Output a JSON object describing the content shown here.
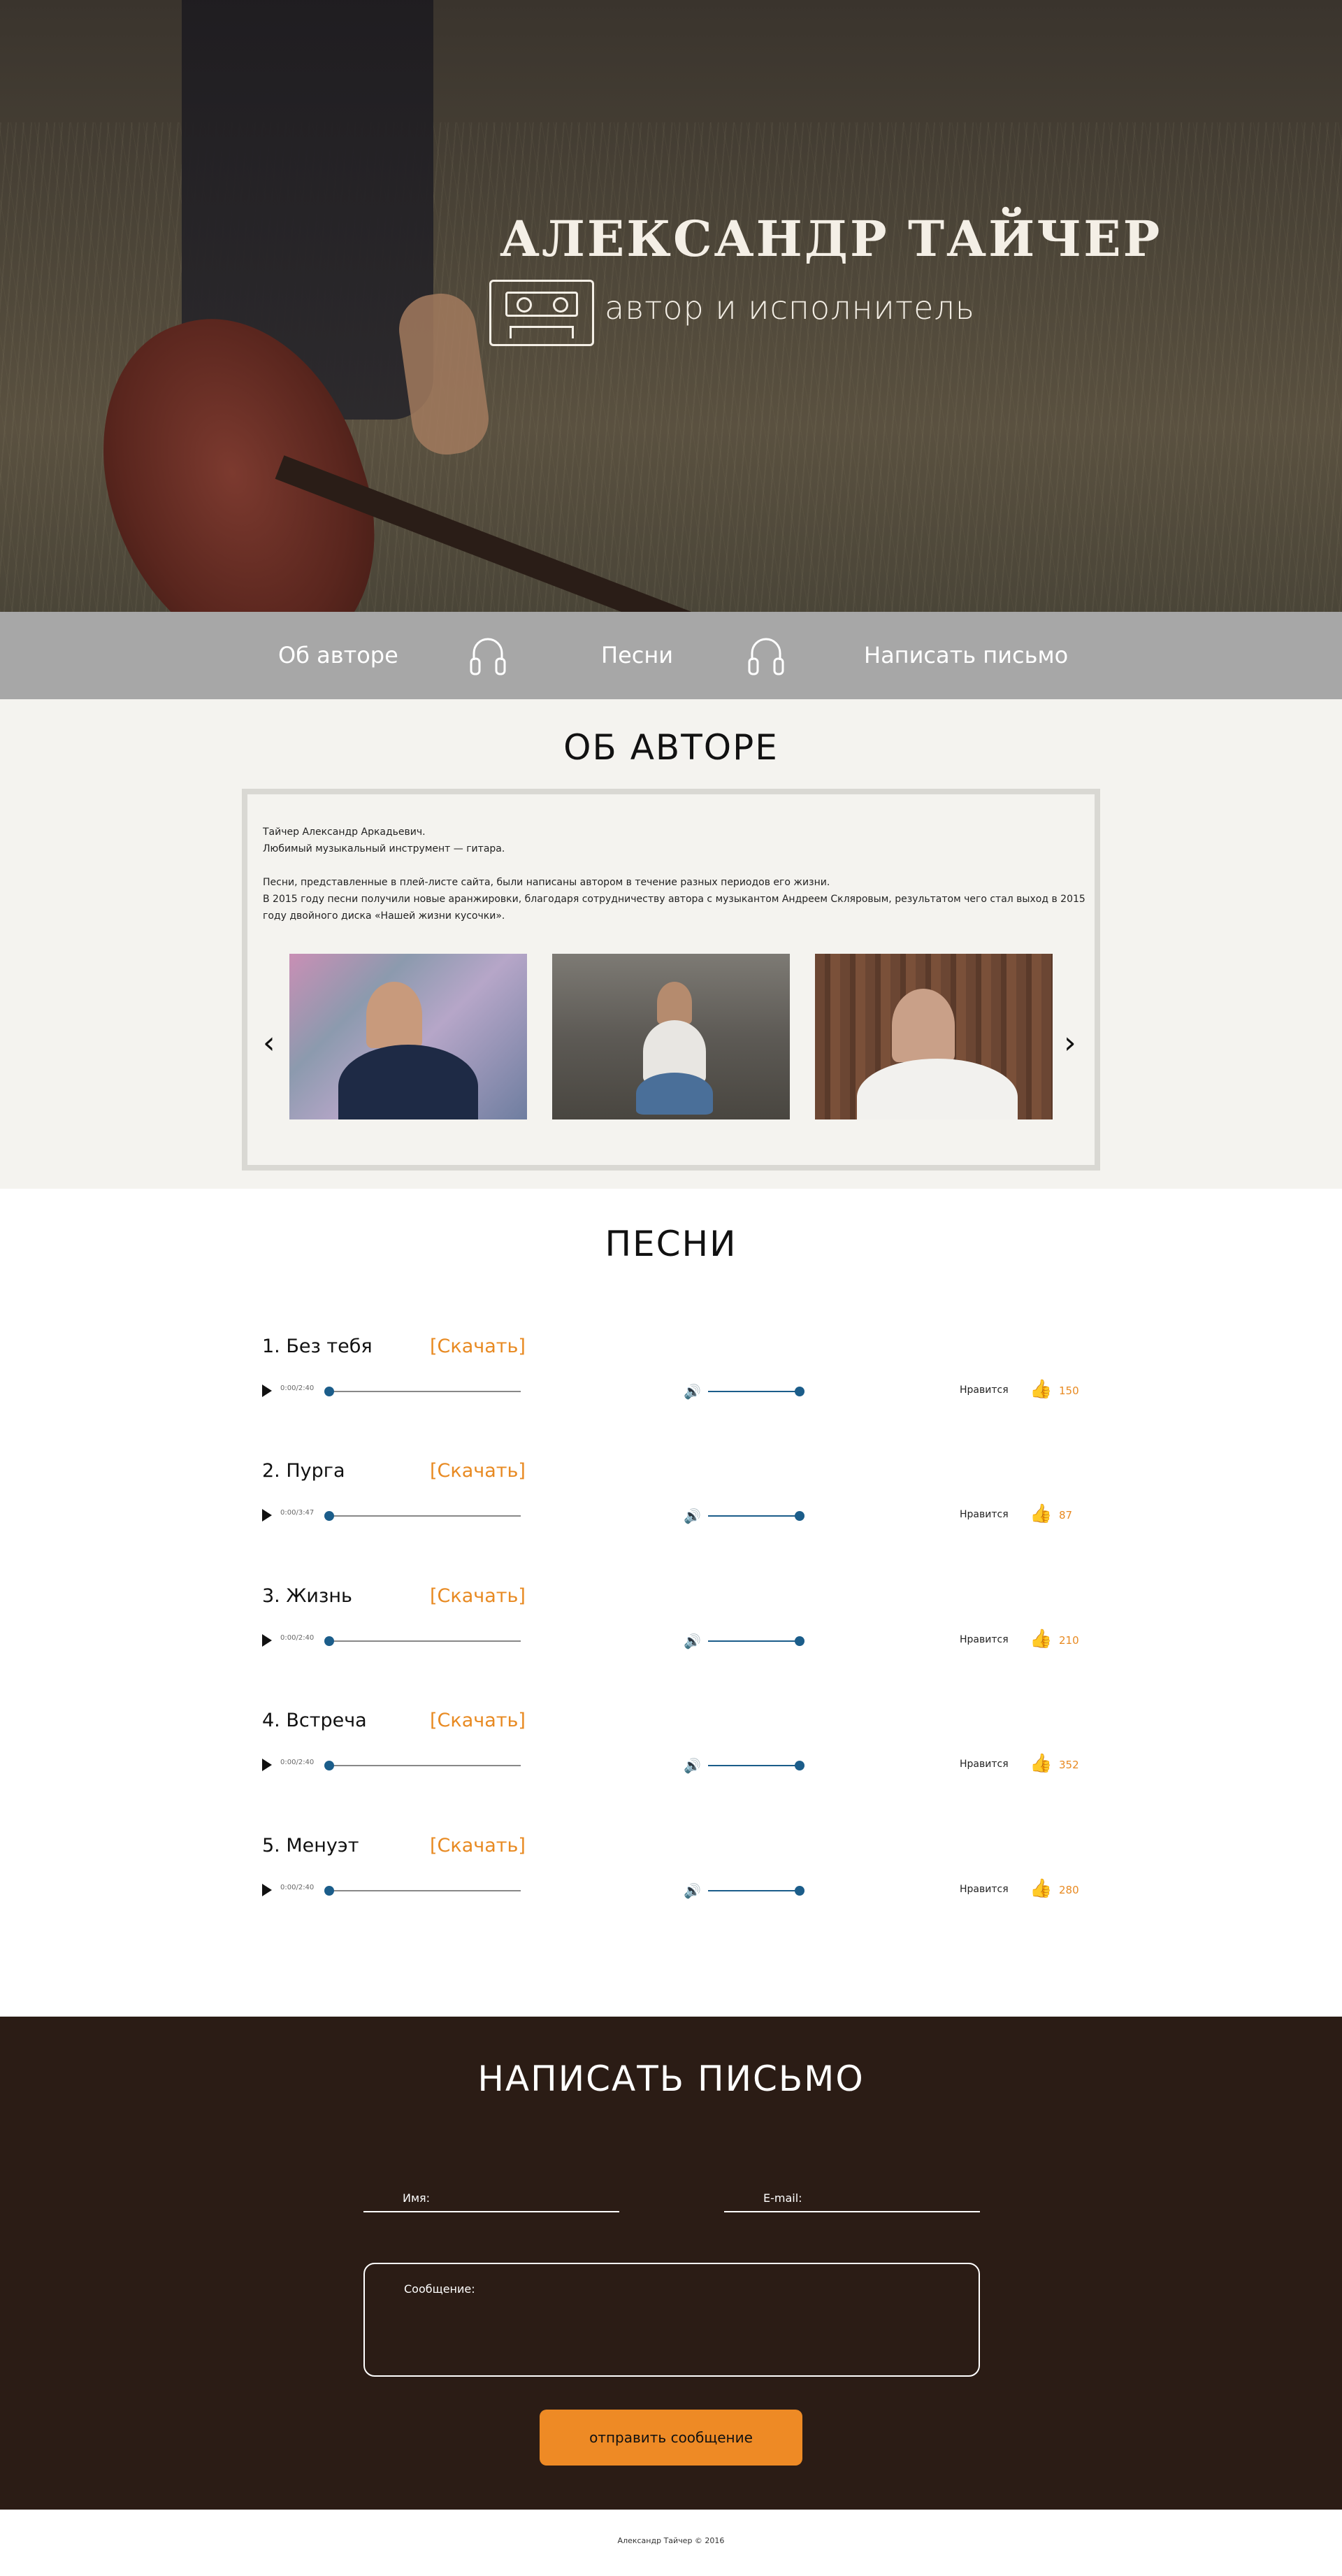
{
  "hero": {
    "title": "АЛЕКСАНДР ТАЙЧЕР",
    "subtitle": "автор и исполнитель"
  },
  "nav": {
    "items": [
      "Об авторе",
      "Песни",
      "Написать письмо"
    ]
  },
  "about": {
    "heading": "ОБ АВТОРЕ",
    "lines": [
      "Тайчер Александр Аркадьевич.",
      "Любимый музыкальный инструмент — гитара.",
      "Песни, представленные в плей-листе сайта, были написаны автором в течение разных периодов его жизни.",
      "В 2015 году песни получили новые аранжировки, благодаря сотрудничеству автора с музыкантом Андреем Скляровым, результатом чего стал выход в 2015 году двойного диска «Нашей жизни кусочки»."
    ],
    "arrow_left": "‹",
    "arrow_right": "›"
  },
  "songs": {
    "heading": "ПЕСНИ",
    "download_label": "[Скачать]",
    "like_label": "Нравится",
    "items": [
      {
        "title": "1. Без тебя",
        "time": "0:00/2:40",
        "likes": "150"
      },
      {
        "title": "2. Пурга",
        "time": "0:00/3:47",
        "likes": "87"
      },
      {
        "title": "3. Жизнь",
        "time": "0:00/2:40",
        "likes": "210"
      },
      {
        "title": "4. Встреча",
        "time": "0:00/2:40",
        "likes": "352"
      },
      {
        "title": "5. Менуэт",
        "time": "0:00/2:40",
        "likes": "280"
      }
    ]
  },
  "contact": {
    "heading": "НАПИСАТЬ ПИСЬМО",
    "name_placeholder": "Имя:",
    "email_placeholder": "E-mail:",
    "message_placeholder": "Сообщение:",
    "send_label": "отправить сообщение"
  },
  "footer": {
    "copyright": "Александр Тайчер © 2016"
  }
}
